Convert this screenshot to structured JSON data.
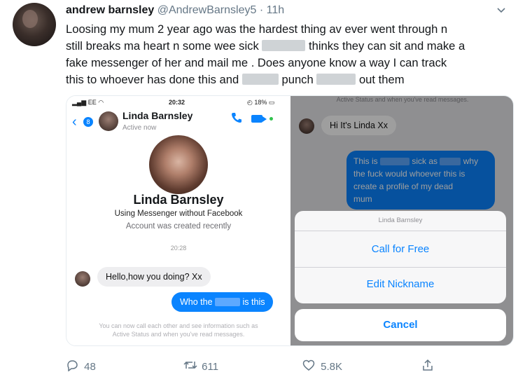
{
  "tweet": {
    "author_name": "andrew barnsley",
    "handle": "@AndrewBarnsley5",
    "separator": "·",
    "time": "11h",
    "lines": [
      [
        "Loosing my mum 2 year ago was the hardest thing av ever went through n"
      ],
      [
        "still breaks ma heart n some wee sick",
        "thinks they can sit and make a"
      ],
      [
        "fake messenger of her and mail me . Does anyone know a way I can track"
      ],
      [
        "this to whoever has done this and",
        "punch",
        "out them"
      ]
    ],
    "actions": {
      "replies": "48",
      "retweets": "611",
      "likes": "5.8K"
    }
  },
  "left_phone": {
    "status_carrier": "EE",
    "status_time": "20:32",
    "status_battery": "18%",
    "badge": "8",
    "contact_name": "Linda Barnsley",
    "active_status": "Active now",
    "profile_name": "Linda Barnsley",
    "profile_subtitle": "Using Messenger without Facebook",
    "profile_subtitle2": "Account was created recently",
    "timestamp": "20:28",
    "incoming_message": "Hello,how you doing? Xx",
    "outgoing_prefix": "Who the",
    "outgoing_suffix": "is this",
    "footer_note_1": "You can now call each other and see information such as",
    "footer_note_2": "Active Status and when you've read messages."
  },
  "right_phone": {
    "top_note": "Active Status and when you've read messages.",
    "incoming_message": "Hi It's Linda Xx",
    "outgoing_parts": [
      "This is",
      "sick as",
      "why",
      "the fuck would whoever this is",
      "create a profile of my dead",
      "mum"
    ],
    "sheet_title": "Linda Barnsley",
    "sheet_call": "Call for Free",
    "sheet_nickname": "Edit Nickname",
    "sheet_cancel": "Cancel"
  },
  "icons": {
    "reply": "reply-icon",
    "retweet": "retweet-icon",
    "like": "like-icon",
    "share": "share-icon",
    "more": "chevron-down-icon"
  },
  "colors": {
    "messenger_blue": "#0a84ff",
    "twitter_gray": "#657786"
  }
}
